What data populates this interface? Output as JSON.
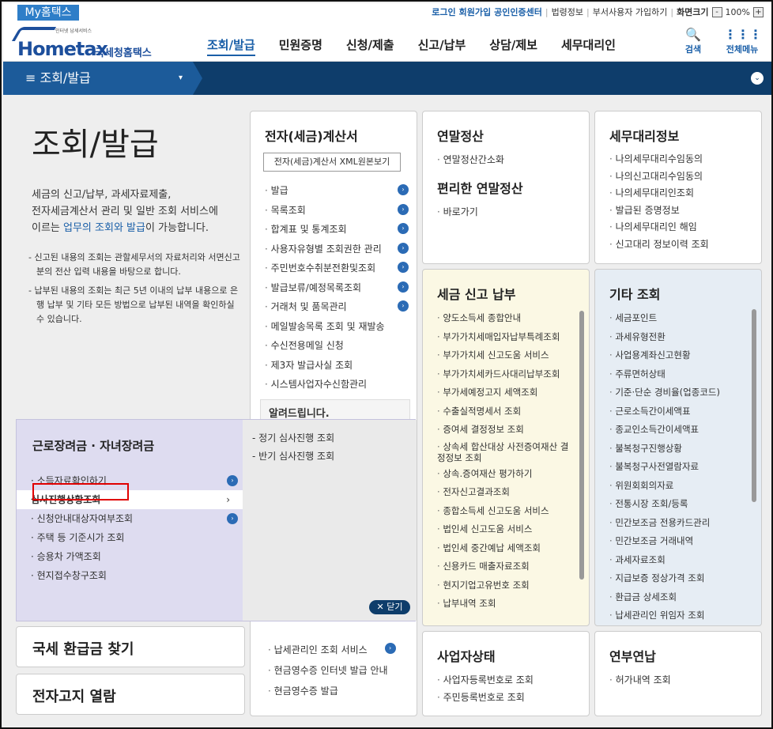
{
  "topbar": {
    "mytax": "My홈택스",
    "links": [
      "로그인",
      "회원가입",
      "공인인증센터"
    ],
    "plain_links": [
      "법령정보",
      "부서사용자 가입하기",
      "화면크기"
    ],
    "zoom": "100%",
    "zoom_minus": "-",
    "zoom_plus": "+"
  },
  "header": {
    "logo_small": "인터넷 납세서비스",
    "logo_text": "Hometax",
    "logo_kr": "국세청홈택스",
    "nav": [
      "조회/발급",
      "민원증명",
      "신청/제출",
      "신고/납부",
      "상담/제보",
      "세무대리인"
    ],
    "search_label": "검색",
    "allmenu_label": "전체메뉴",
    "search_icon": "🔍",
    "allmenu_icon": "⋮⋮⋮"
  },
  "subbar": {
    "current": "≡  조회/발급",
    "drop": "▾",
    "right_icon": "⌄"
  },
  "intro": {
    "title": "조회/발급",
    "desc1": "세금의 신고/납부, 과세자료제출,",
    "desc2": "전자세금계산서 관리 및 일반 조회 서비스에",
    "desc3_pre": "이르는 ",
    "desc3_link": "업무의 조회와 발급",
    "desc3_post": "이 가능합니다.",
    "notes": [
      "- 신고된 내용의 조회는 관할세무서의 자료처리와 서면신고분의 전산 입력 내용을 바탕으로 합니다.",
      "- 납부된 내용의 조회는 최근 5년 이내의 납부 내용으로 은행 납부 및 기타 모든 방법으로 납부된 내역을 확인하실 수 있습니다."
    ]
  },
  "etax": {
    "title": "전자(세금)계산서",
    "button": "전자(세금)계산서 XML원본보기",
    "items": [
      "발급",
      "목록조회",
      "합계표 및 통계조회",
      "사용자유형별 조회권한 관리",
      "주민번호수취분전환및조회",
      "발급보류/예정목록조회",
      "거래처 및 품목관리",
      "메일발송목록 조회 및 재발송",
      "수신전용메일 신청",
      "제3자 발급사실 조회",
      "시스템사업자수신함관리"
    ],
    "notice": "알려드립니다.",
    "bottom": [
      "납세관리인 조회 서비스",
      "현금영수증 인터넷 발급 안내",
      "현금영수증 발급"
    ]
  },
  "yearend": {
    "title": "연말정산",
    "items": [
      "연말정산간소화"
    ],
    "title2": "편리한 연말정산",
    "items2": [
      "바로가기"
    ]
  },
  "agent": {
    "title": "세무대리정보",
    "items": [
      "나의세무대리수임동의",
      "나의신고대리수임동의",
      "나의세무대리인조회",
      "발급된 증명정보",
      "나의세무대리인 해임",
      "신고대리 정보이력 조회"
    ]
  },
  "taxpay": {
    "title": "세금 신고 납부",
    "items": [
      "양도소득세 종합안내",
      "부가가치세매입자납부특례조회",
      "부가가치세 신고도움 서비스",
      "부가가치세카드사대리납부조회",
      "부가세예정고지 세액조회",
      "수출실적명세서 조회",
      "증여세 결정정보 조회",
      "상속세 합산대상 사전증여재산 결정정보 조회",
      "상속.증여재산 평가하기",
      "전자신고결과조회",
      "종합소득세 신고도움 서비스",
      "법인세 신고도움 서비스",
      "법인세 중간예납 세액조회",
      "신용카드 매출자료조회",
      "현지기업고유번호 조회",
      "납부내역 조회"
    ]
  },
  "other": {
    "title": "기타 조회",
    "items": [
      "세금포인트",
      "과세유형전환",
      "사업용계좌신고현황",
      "주류면허상태",
      "기준·단순 경비율(업종코드)",
      "근로소득간이세액표",
      "종교인소득간이세액표",
      "불복청구진행상황",
      "불복청구사전열람자료",
      "위원회회의자료",
      "전통시장 조회/등록",
      "민간보조금 전용카드관리",
      "민간보조금 거래내역",
      "과세자료조회",
      "지급보증 정상가격 조회",
      "환급금 상세조회",
      "납세관리인 위임자 조회"
    ]
  },
  "business": {
    "title": "사업자상태",
    "items": [
      "사업자등록번호로 조회",
      "주민등록번호로 조회"
    ]
  },
  "installment": {
    "title": "연부연납",
    "items": [
      "허가내역 조회"
    ]
  },
  "overlay": {
    "title": "근로장려금 · 자녀장려금",
    "items": [
      "소득자료확인하기",
      "심사진행상황조회",
      "신청안내대상자여부조회",
      "주택 등 기준시가 조회",
      "승용차 가액조회",
      "현지접수창구조회"
    ],
    "sub": [
      "정기 심사진행 조회",
      "반기 심사진행 조회"
    ],
    "close": "✕ 닫기",
    "sel_arrow": "›"
  },
  "refund": "국세 환급금 찾기",
  "enotice": "전자고지 열람",
  "colors": {
    "primary": "#1a5fa8",
    "navy": "#0e3d6b",
    "highlight": "#e00000"
  }
}
